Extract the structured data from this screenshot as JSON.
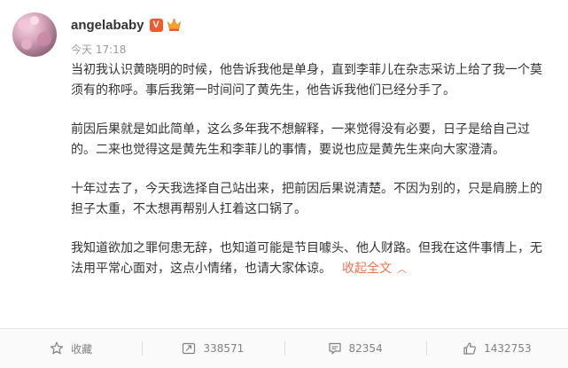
{
  "post": {
    "username": "angelababy",
    "verified_mark": "V",
    "time": "今天 17:18",
    "paragraphs": [
      "当初我认识黄晓明的时候，他告诉我他是单身，直到李菲儿在杂志采访上给了我一个莫须有的称呼。事后我第一时间问了黄先生，他告诉我他们已经分手了。",
      "前因后果就是如此简单，这么多年我不想解释，一来觉得没有必要，日子是给自己过的。二来也觉得这是黄先生和李菲儿的事情，要说也应是黄先生来向大家澄清。",
      "十年过去了，今天我选择自己站出来，把前因后果说清楚。不因为别的，只是肩膀上的担子太重，不太想再帮别人扛着这口锅了。",
      "我知道欲加之罪何患无辞，也知道可能是节目噱头、他人财路。但我在这件事情上，无法用平常心面对，这点小情绪，也请大家体谅。"
    ],
    "collapse_label": "收起全文",
    "collapse_icon": "chevron-up-icon"
  },
  "actions": {
    "favorite": {
      "label": "收藏",
      "icon": "star-icon"
    },
    "repost": {
      "count": "338571",
      "icon": "repost-icon"
    },
    "comment": {
      "count": "82354",
      "icon": "comment-icon"
    },
    "like": {
      "count": "1432753",
      "icon": "thumbs-up-icon"
    }
  },
  "colors": {
    "accent": "#eb7350",
    "verified": "#f0592b",
    "muted": "#999999",
    "text": "#333333"
  }
}
